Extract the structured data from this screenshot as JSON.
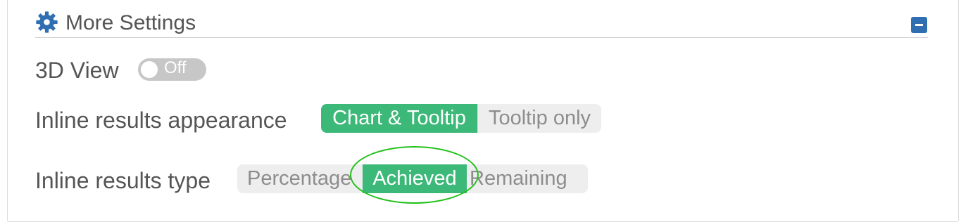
{
  "header": {
    "title": "More Settings",
    "icon": "gear-icon",
    "collapse_icon": "minus-icon"
  },
  "view3d": {
    "label": "3D View",
    "toggle_text": "Off",
    "enabled": false
  },
  "appearance": {
    "label": "Inline results appearance",
    "options": [
      "Chart & Tooltip",
      "Tooltip only"
    ],
    "selected": "Chart & Tooltip"
  },
  "results_type": {
    "label": "Inline results type",
    "options": [
      "Percentage",
      "Achieved",
      "Remaining"
    ],
    "selected": "Achieved"
  },
  "colors": {
    "accent": "#3cb878",
    "header_button": "#2f6fb1",
    "highlight": "#22c11a"
  }
}
